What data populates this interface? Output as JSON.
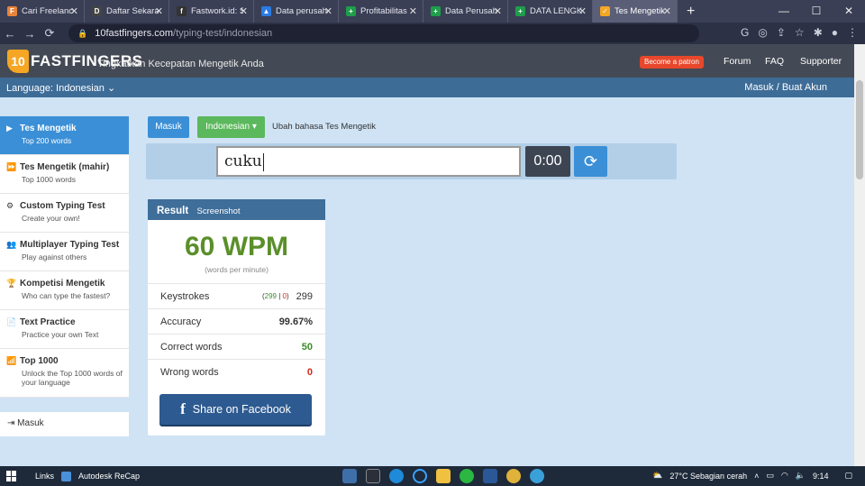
{
  "browser": {
    "tabs": [
      {
        "title": "Cari Freelance",
        "color": "#e8833a",
        "icon": "F"
      },
      {
        "title": "Daftar Sekarang",
        "color": "#444",
        "icon": "D"
      },
      {
        "title": "Fastwork.id: S",
        "color": "#333",
        "icon": "f"
      },
      {
        "title": "Data perusahaan",
        "color": "#2a7be4",
        "icon": "▲"
      },
      {
        "title": "Profitabilitas",
        "color": "#1e9e4a",
        "icon": "+"
      },
      {
        "title": "Data Perusahaan",
        "color": "#1e9e4a",
        "icon": "+"
      },
      {
        "title": "DATA LENGKAP",
        "color": "#1e9e4a",
        "icon": "+"
      },
      {
        "title": "Tes Mengetik",
        "color": "#f5a623",
        "icon": "✓"
      }
    ],
    "new_tab": "+",
    "url_host": "10fastfingers.com",
    "url_path": "/typing-test/indonesian"
  },
  "header": {
    "logo_prefix": "10",
    "logo_text": "FASTFINGERS",
    "tagline": "Tingkatkan Kecepatan Mengetik Anda",
    "patron": "Become a patron",
    "forum": "Forum",
    "faq": "FAQ",
    "supporter": "Supporter",
    "language": "Language: Indonesian",
    "login": "Masuk / Buat Akun"
  },
  "sidebar": {
    "items": [
      {
        "title": "Tes Mengetik",
        "sub": "Top 200 words",
        "icon": "▶"
      },
      {
        "title": "Tes Mengetik (mahir)",
        "sub": "Top 1000 words",
        "icon": "⏩"
      },
      {
        "title": "Custom Typing Test",
        "sub": "Create your own!",
        "icon": "⚙"
      },
      {
        "title": "Multiplayer Typing Test",
        "sub": "Play against others",
        "icon": "👥"
      },
      {
        "title": "Kompetisi Mengetik",
        "sub": "Who can type the fastest?",
        "icon": "🏆"
      },
      {
        "title": "Text Practice",
        "sub": "Practice your own Text",
        "icon": "📄"
      },
      {
        "title": "Top 1000",
        "sub": "Unlock the Top 1000 words of your language",
        "icon": "📶"
      }
    ],
    "login": "Masuk"
  },
  "controls": {
    "masuk": "Masuk",
    "language_button": "Indonesian ▾",
    "language_note": "Ubah bahasa Tes Mengetik",
    "input_value": "cuku",
    "timer": "0:00",
    "refresh": "⟳"
  },
  "result": {
    "title": "Result",
    "screenshot": "Screenshot",
    "wpm": "60 WPM",
    "wpm_sub": "(words per minute)",
    "keystrokes_label": "Keystrokes",
    "keystrokes_correct": "299",
    "keystrokes_wrong": "0",
    "keystrokes_total": "299",
    "accuracy_label": "Accuracy",
    "accuracy_value": "99.67%",
    "correct_label": "Correct words",
    "correct_value": "50",
    "wrong_label": "Wrong words",
    "wrong_value": "0",
    "facebook": "Share on Facebook"
  },
  "taskbar": {
    "links": "Links",
    "app": "Autodesk ReCap",
    "weather": "27°C  Sebagian cerah",
    "time": "9:14"
  }
}
